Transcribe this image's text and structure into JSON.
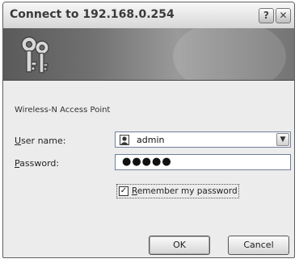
{
  "window": {
    "title": "Connect to 192.168.0.254"
  },
  "title_buttons": {
    "help_label": "?",
    "close_label": "✕"
  },
  "server_text": "Wireless-N Access Point",
  "form": {
    "username_label_underlined": "U",
    "username_label_rest": "ser name:",
    "username_value": "admin",
    "password_label_underlined": "P",
    "password_label_rest": "assword:",
    "password_value": "●●●●●",
    "remember_checked": true,
    "remember_label_underlined": "R",
    "remember_label_rest": "emember my password"
  },
  "buttons": {
    "ok_label": "OK",
    "cancel_label": "Cancel"
  },
  "icons": {
    "keys": "keys-icon",
    "user": "user-avatar-icon",
    "dropdown": "chevron-down-icon",
    "check": "checkmark-icon"
  }
}
